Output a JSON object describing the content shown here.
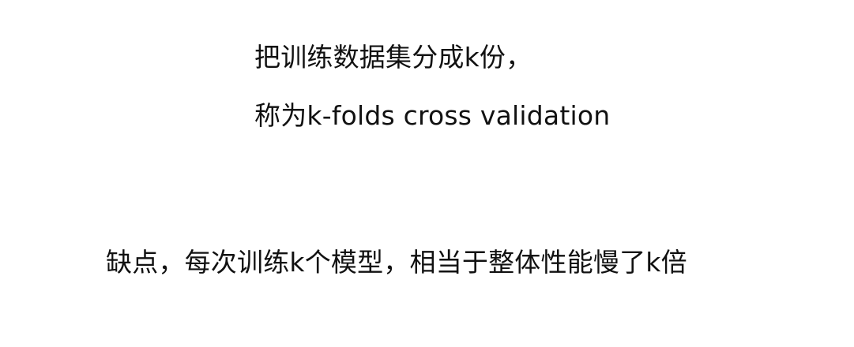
{
  "slide": {
    "line_1": "把训练数据集分成k份，",
    "line_2": "称为k-folds cross validation",
    "line_3": "缺点，每次训练k个模型，相当于整体性能慢了k倍"
  }
}
